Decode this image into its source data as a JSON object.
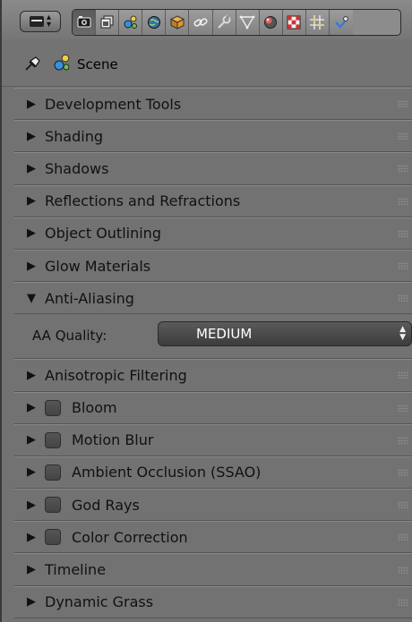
{
  "toolbar": {
    "editor_type": "properties-editor",
    "tabs": [
      {
        "icon": "render-camera-icon",
        "active": true
      },
      {
        "icon": "render-layers-icon",
        "active": false
      },
      {
        "icon": "scene-icon",
        "active": false
      },
      {
        "icon": "world-icon",
        "active": false
      },
      {
        "icon": "object-icon",
        "active": false
      },
      {
        "icon": "constraints-icon",
        "active": false
      },
      {
        "icon": "modifiers-icon",
        "active": false
      },
      {
        "icon": "data-icon",
        "active": false
      },
      {
        "icon": "material-icon",
        "active": false
      },
      {
        "icon": "texture-icon",
        "active": false
      },
      {
        "icon": "particles-icon",
        "active": false
      },
      {
        "icon": "physics-icon",
        "active": false
      }
    ]
  },
  "context": {
    "label": "Scene"
  },
  "panels": [
    {
      "label": "Development Tools",
      "expanded": false,
      "checkbox": false
    },
    {
      "label": "Shading",
      "expanded": false,
      "checkbox": false
    },
    {
      "label": "Shadows",
      "expanded": false,
      "checkbox": false
    },
    {
      "label": "Reflections and Refractions",
      "expanded": false,
      "checkbox": false
    },
    {
      "label": "Object Outlining",
      "expanded": false,
      "checkbox": false
    },
    {
      "label": "Glow Materials",
      "expanded": false,
      "checkbox": false
    },
    {
      "label": "Anti-Aliasing",
      "expanded": true,
      "checkbox": false
    },
    {
      "label": "Anisotropic Filtering",
      "expanded": false,
      "checkbox": false
    },
    {
      "label": "Bloom",
      "expanded": false,
      "checkbox": true
    },
    {
      "label": "Motion Blur",
      "expanded": false,
      "checkbox": true
    },
    {
      "label": "Ambient Occlusion (SSAO)",
      "expanded": false,
      "checkbox": true
    },
    {
      "label": "God Rays",
      "expanded": false,
      "checkbox": true
    },
    {
      "label": "Color Correction",
      "expanded": false,
      "checkbox": true
    },
    {
      "label": "Timeline",
      "expanded": false,
      "checkbox": false
    },
    {
      "label": "Dynamic Grass",
      "expanded": false,
      "checkbox": false
    }
  ],
  "anti_aliasing": {
    "quality_label": "AA Quality:",
    "quality_value": "MEDIUM"
  },
  "glyphs": {
    "collapsed": "▶",
    "expanded": "▼"
  }
}
